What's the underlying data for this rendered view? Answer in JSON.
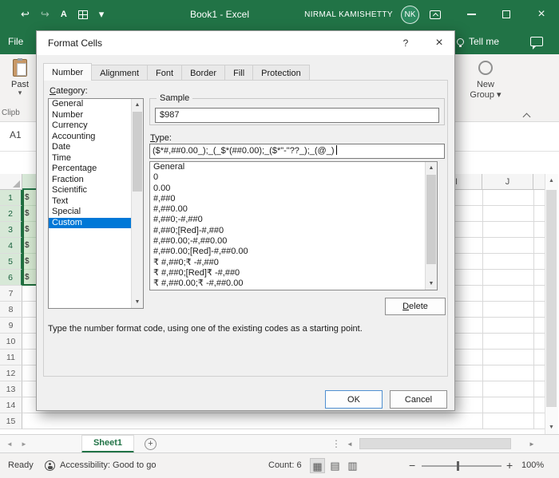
{
  "titlebar": {
    "title": "Book1 - Excel",
    "user_name": "NIRMAL KAMISHETTY",
    "avatar_initials": "NK"
  },
  "ribbon": {
    "file_tab": "File",
    "tell_me": "Tell me",
    "paste_label": "Past",
    "clipboard_group_label": "Clipb",
    "new_group_line1": "New",
    "new_group_line2": "Group"
  },
  "formula_bar": {
    "name_box": "A1"
  },
  "dialog": {
    "title": "Format Cells",
    "tabs": [
      "Number",
      "Alignment",
      "Font",
      "Border",
      "Fill",
      "Protection"
    ],
    "active_tab": "Number",
    "category_label": "Category:",
    "categories": [
      "General",
      "Number",
      "Currency",
      "Accounting",
      "Date",
      "Time",
      "Percentage",
      "Fraction",
      "Scientific",
      "Text",
      "Special",
      "Custom"
    ],
    "selected_category": "Custom",
    "sample_label": "Sample",
    "sample_value": "$987",
    "type_label": "Type:",
    "type_value": "($*#,##0.00_);_(_$*(##0.00);_($*\"-\"??_);_(@_)",
    "type_options": [
      "General",
      "0",
      "0.00",
      "#,##0",
      "#,##0.00",
      "#,##0;-#,##0",
      "#,##0;[Red]-#,##0",
      "#,##0.00;-#,##0.00",
      "#,##0.00;[Red]-#,##0.00",
      "₹ #,##0;₹ -#,##0",
      "₹ #,##0;[Red]₹ -#,##0",
      "₹ #,##0.00;₹ -#,##0.00"
    ],
    "delete_button": "Delete",
    "help_text": "Type the number format code, using one of the existing codes as a starting point.",
    "ok_button": "OK",
    "cancel_button": "Cancel"
  },
  "grid": {
    "column_headers": [
      "I",
      "J"
    ],
    "row_numbers": [
      "1",
      "2",
      "3",
      "4",
      "5",
      "6",
      "7",
      "8",
      "9",
      "10",
      "11",
      "12",
      "13",
      "14",
      "15"
    ],
    "selected_cell_values": [
      "$",
      "$",
      "$",
      "$",
      "$",
      "$"
    ]
  },
  "sheet_bar": {
    "sheet_name": "Sheet1"
  },
  "status_bar": {
    "mode": "Ready",
    "accessibility": "Accessibility: Good to go",
    "count": "Count: 6",
    "zoom_level": "100%"
  },
  "icons": {
    "undo": "↩",
    "redo": "↪",
    "caret_down": "▾",
    "font_color_letter": "A",
    "close": "×",
    "help": "?",
    "scroll_up": "▲",
    "scroll_down": "▼",
    "scroll_left": "◄",
    "scroll_right": "►",
    "add_sheet": "+",
    "divider_dots": "⋮",
    "view_normal": "▦",
    "view_page_layout": "▤",
    "view_page_break": "▥",
    "zoom_out": "−",
    "zoom_in": "+"
  },
  "colors": {
    "excel_green": "#217346",
    "selection_blue": "#0078d7",
    "cell_fill_green": "#d6e9d2"
  }
}
